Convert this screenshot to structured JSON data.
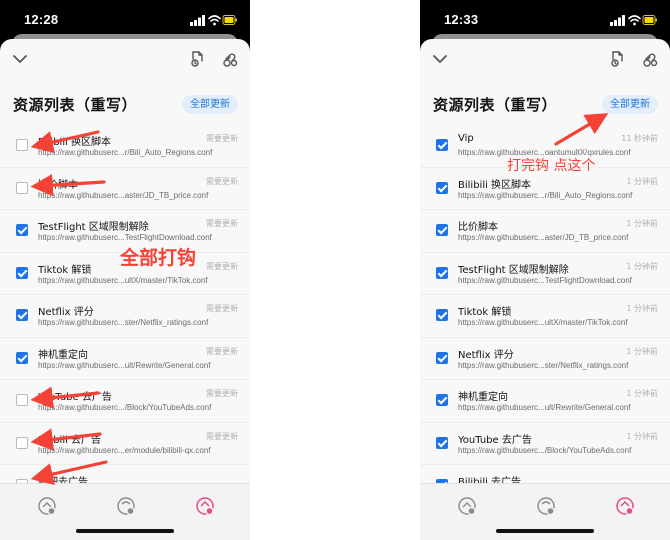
{
  "colors": {
    "accent": "#1e73e8",
    "annotation": "#f44336",
    "active_tab": "#e8498a"
  },
  "icons": {
    "toolbar": [
      "chevron-down-icon",
      "document-sync-icon",
      "link-sync-icon"
    ],
    "tabs": [
      "rule-list-icon",
      "filter-icon",
      "rewrite-icon"
    ]
  },
  "left_phone": {
    "status_time": "12:28",
    "title": "资源列表（重写）",
    "update_all": "全部更新",
    "annotation": "全部打钩",
    "rules": [
      {
        "name": "Bilibili 换区脚本",
        "url": "https://raw.githubuserc...r/Bili_Auto_Regions.conf",
        "status": "需要更新",
        "checked": false
      },
      {
        "name": "比价脚本",
        "url": "https://raw.githubuserc...aster/JD_TB_price.conf",
        "status": "需要更新",
        "checked": false
      },
      {
        "name": "TestFlight 区域限制解除",
        "url": "https://raw.githubuserc...TestFlightDownload.conf",
        "status": "需要更新",
        "checked": true
      },
      {
        "name": "Tiktok 解锁",
        "url": "https://raw.githubuserc...ultX/master/TikTok.conf",
        "status": "需要更新",
        "checked": true
      },
      {
        "name": "Netflix 评分",
        "url": "https://raw.githubuserc...ster/Netflix_ratings.conf",
        "status": "需要更新",
        "checked": true
      },
      {
        "name": "神机重定向",
        "url": "https://raw.githubuserc...ult/Rewrite/General.conf",
        "status": "需要更新",
        "checked": true
      },
      {
        "name": "YouTube 去广告",
        "url": "https://raw.githubuserc.../Block/YouTubeAds.conf",
        "status": "需要更新",
        "checked": false
      },
      {
        "name": "Bilibili 去广告",
        "url": "https://raw.githubuserc...er/module/bilibili-qx.conf",
        "status": "需要更新",
        "checked": false
      },
      {
        "name": "贴吧去广告",
        "url": "",
        "status": "",
        "checked": false
      }
    ]
  },
  "right_phone": {
    "status_time": "12:33",
    "title": "资源列表（重写）",
    "update_all": "全部更新",
    "annotation": "打完钩 点这个",
    "rules": [
      {
        "name": "Vip",
        "url": "https://raw.githubuserc...oantumultX/qxrules.conf",
        "status": "11 秒钟前",
        "checked": true
      },
      {
        "name": "Bilibili 换区脚本",
        "url": "https://raw.githubuserc...r/Bili_Auto_Regions.conf",
        "status": "1 分钟前",
        "checked": true
      },
      {
        "name": "比价脚本",
        "url": "https://raw.githubuserc...aster/JD_TB_price.conf",
        "status": "1 分钟前",
        "checked": true
      },
      {
        "name": "TestFlight 区域限制解除",
        "url": "https://raw.githubuserc...TestFlightDownload.conf",
        "status": "1 分钟前",
        "checked": true
      },
      {
        "name": "Tiktok 解锁",
        "url": "https://raw.githubuserc...ultX/master/TikTok.conf",
        "status": "1 分钟前",
        "checked": true
      },
      {
        "name": "Netflix 评分",
        "url": "https://raw.githubuserc...ster/Netflix_ratings.conf",
        "status": "1 分钟前",
        "checked": true
      },
      {
        "name": "神机重定向",
        "url": "https://raw.githubuserc...ult/Rewrite/General.conf",
        "status": "1 分钟前",
        "checked": true
      },
      {
        "name": "YouTube 去广告",
        "url": "https://raw.githubuserc.../Block/YouTubeAds.conf",
        "status": "1 分钟前",
        "checked": true
      },
      {
        "name": "Bilibili 去广告",
        "url": "",
        "status": "",
        "checked": true
      }
    ]
  }
}
